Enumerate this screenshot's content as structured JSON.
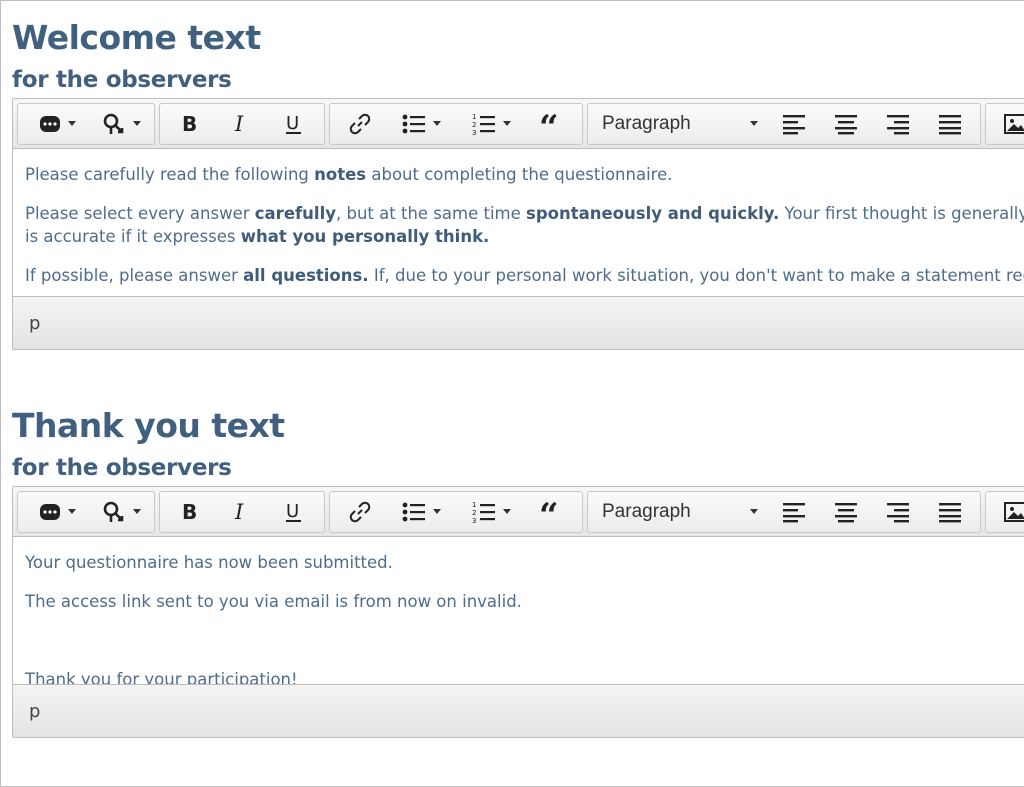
{
  "sections": [
    {
      "title": "Welcome text",
      "subtitle": "for the observers",
      "format_select": "Paragraph",
      "paragraphs": [
        [
          {
            "t": "Please carefully read the following ",
            "b": false
          },
          {
            "t": "notes",
            "b": true
          },
          {
            "t": " about completing the questionnaire.",
            "b": false
          }
        ],
        [
          {
            "t": "Please select every answer ",
            "b": false
          },
          {
            "t": "carefully",
            "b": true
          },
          {
            "t": ", but at the same time ",
            "b": false
          },
          {
            "t": "spontaneously and quickly.",
            "b": true
          },
          {
            "t": " Your first thought is generally als",
            "b": false
          }
        ],
        [
          {
            "t": "is accurate if it expresses ",
            "b": false
          },
          {
            "t": "what you personally think.",
            "b": true
          }
        ],
        [
          {
            "t": "If possible, please answer ",
            "b": false
          },
          {
            "t": "all questions.",
            "b": true
          },
          {
            "t": " If, due to your personal work situation, you don't want to make a statement rega",
            "b": false
          }
        ]
      ],
      "status_path": "p"
    },
    {
      "title": "Thank you text",
      "subtitle": "for the observers",
      "format_select": "Paragraph",
      "paragraphs": [
        [
          {
            "t": "Your questionnaire has now been submitted.",
            "b": false
          }
        ],
        [
          {
            "t": "The access link sent to you via email is from now on invalid.",
            "b": false
          }
        ],
        [
          {
            "t": "",
            "b": false
          }
        ],
        [
          {
            "t": "Thank you for your participation!",
            "b": false
          }
        ]
      ],
      "status_path": "p"
    }
  ],
  "toolbar_icons": [
    "more-icon",
    "format-paint-icon",
    "bold-icon",
    "italic-icon",
    "underline-icon",
    "link-icon",
    "bulleted-list-icon",
    "numbered-list-icon",
    "blockquote-icon",
    "align-left-icon",
    "align-center-icon",
    "align-right-icon",
    "align-justify-icon",
    "image-icon"
  ]
}
